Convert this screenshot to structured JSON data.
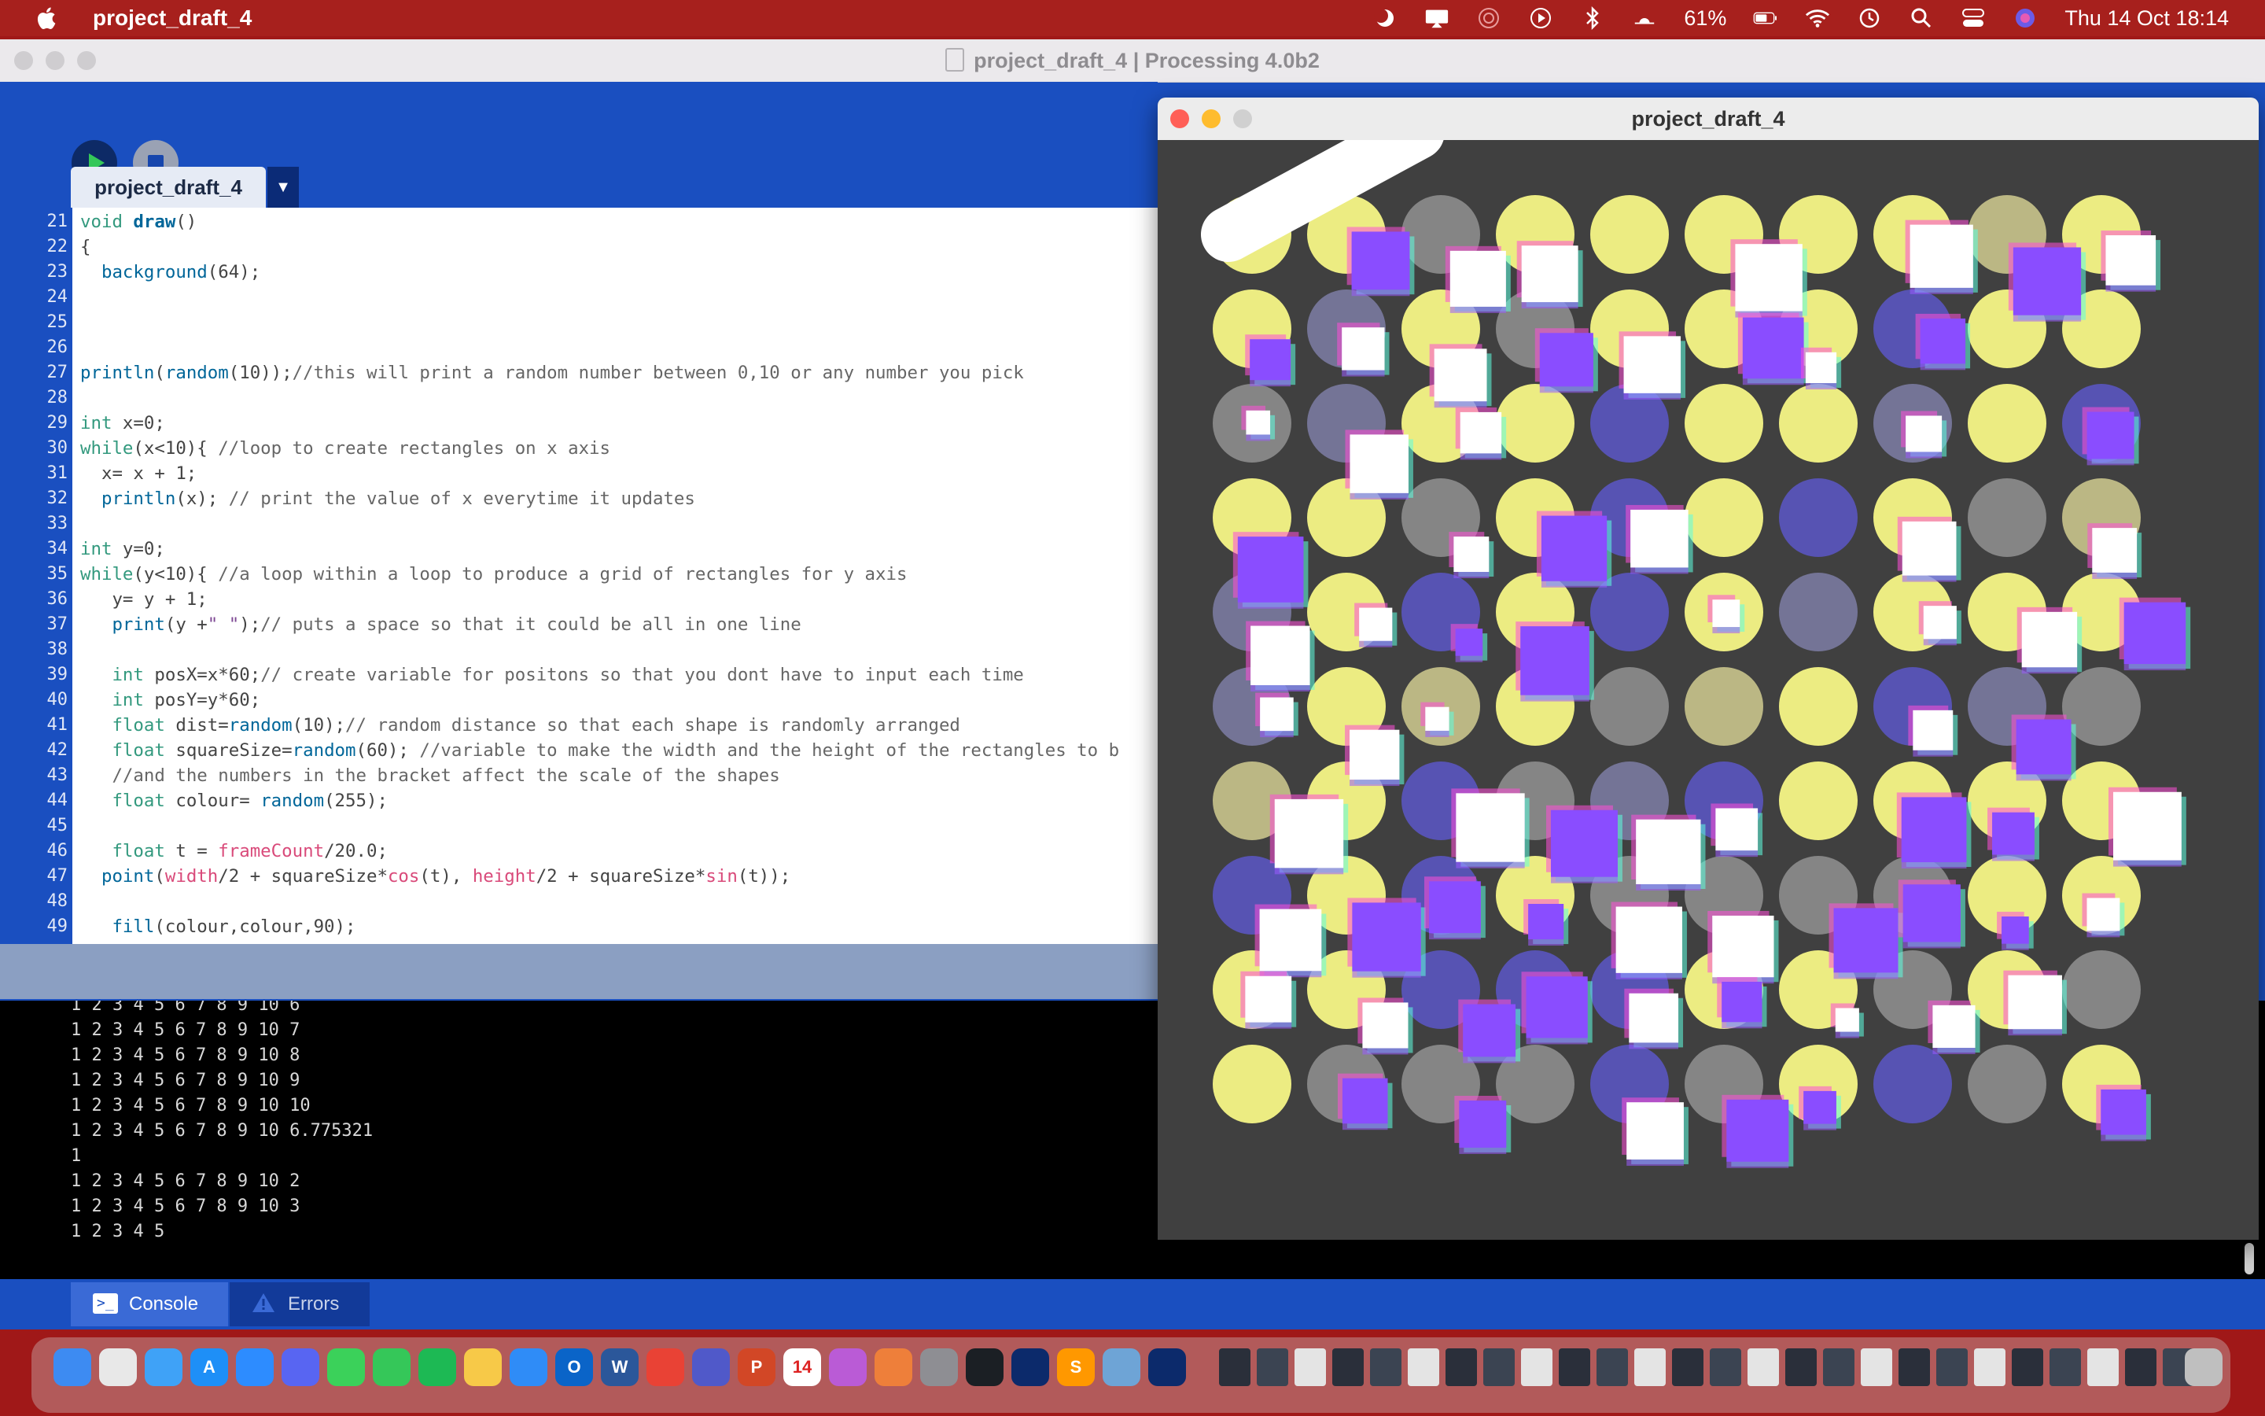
{
  "menubar": {
    "app_name": "project_draft_4",
    "battery": "61%",
    "datetime": "Thu 14 Oct  18:14"
  },
  "ide": {
    "window_title": "project_draft_4 | Processing 4.0b2",
    "tab_label": "project_draft_4",
    "code_lines": [
      {
        "n": "21",
        "html": "<span class='kw'>void</span> <span class='fn bold'>draw</span>()"
      },
      {
        "n": "22",
        "html": "{"
      },
      {
        "n": "23",
        "html": "  <span class='fn'>background</span>(64);"
      },
      {
        "n": "24",
        "html": ""
      },
      {
        "n": "25",
        "html": ""
      },
      {
        "n": "26",
        "html": ""
      },
      {
        "n": "27",
        "html": "<span class='fn'>println</span>(<span class='fn'>random</span>(10));<span class='cm'>//this will print a random number between 0,10 or any number you pick</span>"
      },
      {
        "n": "28",
        "html": ""
      },
      {
        "n": "29",
        "html": "<span class='kw'>int</span> x=0;"
      },
      {
        "n": "30",
        "html": "<span class='kw'>while</span>(x&lt;10){ <span class='cm'>//loop to create rectangles on x axis</span>"
      },
      {
        "n": "31",
        "html": "  x= x + 1;"
      },
      {
        "n": "32",
        "html": "  <span class='fn'>println</span>(x); <span class='cm'>// print the value of x everytime it updates</span>"
      },
      {
        "n": "33",
        "html": ""
      },
      {
        "n": "34",
        "html": "<span class='kw'>int</span> y=0;"
      },
      {
        "n": "35",
        "html": "<span class='kw'>while</span>(y&lt;10){ <span class='cm'>//a loop within a loop to produce a grid of rectangles for y axis</span>"
      },
      {
        "n": "36",
        "html": "   y= y + 1;"
      },
      {
        "n": "37",
        "html": "   <span class='fn'>print</span>(y +<span class='st'>\" \"</span>);<span class='cm'>// puts a space so that it could be all in one line</span>"
      },
      {
        "n": "38",
        "html": ""
      },
      {
        "n": "39",
        "html": "   <span class='kw'>int</span> posX=x*60;<span class='cm'>// create variable for positons so that you dont have to input each time</span>"
      },
      {
        "n": "40",
        "html": "   <span class='kw'>int</span> posY=y*60;"
      },
      {
        "n": "41",
        "html": "   <span class='kw'>float</span> dist=<span class='fn'>random</span>(10);<span class='cm'>// random distance so that each shape is randomly arranged</span>"
      },
      {
        "n": "42",
        "html": "   <span class='kw'>float</span> squareSize=<span class='fn'>random</span>(60); <span class='cm'>//variable to make the width and the height of the rectangles to b</span>"
      },
      {
        "n": "43",
        "html": "   <span class='cm'>//and the numbers in the bracket affect the scale of the shapes</span>"
      },
      {
        "n": "44",
        "html": "   <span class='kw'>float</span> colour= <span class='fn'>random</span>(255);"
      },
      {
        "n": "45",
        "html": ""
      },
      {
        "n": "46",
        "html": "   <span class='kw'>float</span> t = <span class='sys'>frameCount</span>/20.0;"
      },
      {
        "n": "47",
        "html": "  <span class='fn'>point</span>(<span class='sys'>width</span>/2 + squareSize*<span class='sys'>cos</span>(t), <span class='sys'>height</span>/2 + squareSize*<span class='sys'>sin</span>(t));"
      },
      {
        "n": "48",
        "html": ""
      },
      {
        "n": "49",
        "html": "   <span class='fn'>fill</span>(colour,colour,90);"
      }
    ],
    "console_lines": [
      "1 2 3 4 5 6 7 8 9 10 6",
      "1 2 3 4 5 6 7 8 9 10 7",
      "1 2 3 4 5 6 7 8 9 10 8",
      "1 2 3 4 5 6 7 8 9 10 9",
      "1 2 3 4 5 6 7 8 9 10 10",
      "1 2 3 4 5 6 7 8 9 10 6.775321",
      "1",
      "1 2 3 4 5 6 7 8 9 10 2",
      "1 2 3 4 5 6 7 8 9 10 3",
      "1 2 3 4 5"
    ],
    "console_tab": "Console",
    "errors_tab": "Errors"
  },
  "sketch": {
    "window_title": "project_draft_4",
    "background": "#404040",
    "grid_cols": 10,
    "grid_rows": 10
  },
  "colors": {
    "ide_blue": "#1a4fc0",
    "menubar_red": "#a7201d",
    "keyword_green": "#33997e",
    "function_blue": "#006699"
  },
  "dock": {
    "icons": [
      {
        "name": "finder",
        "color": "#3d8bf2",
        "glyph": ""
      },
      {
        "name": "launchpad",
        "color": "#e8e8e8",
        "glyph": ""
      },
      {
        "name": "mail",
        "color": "#3fa2f7",
        "glyph": ""
      },
      {
        "name": "app-store",
        "color": "#1e8ff7",
        "glyph": "A"
      },
      {
        "name": "zoom",
        "color": "#2d8cff",
        "glyph": ""
      },
      {
        "name": "discord",
        "color": "#5865f2",
        "glyph": ""
      },
      {
        "name": "messages",
        "color": "#3bd15a",
        "glyph": ""
      },
      {
        "name": "facetime",
        "color": "#35c759",
        "glyph": ""
      },
      {
        "name": "spotify",
        "color": "#1db954",
        "glyph": ""
      },
      {
        "name": "photos",
        "color": "#f7c948",
        "glyph": ""
      },
      {
        "name": "safari",
        "color": "#2f8cf7",
        "glyph": ""
      },
      {
        "name": "outlook",
        "color": "#0a64c8",
        "glyph": "O"
      },
      {
        "name": "word",
        "color": "#2b579a",
        "glyph": "W"
      },
      {
        "name": "chrome",
        "color": "#e94235",
        "glyph": ""
      },
      {
        "name": "teams",
        "color": "#5059c9",
        "glyph": ""
      },
      {
        "name": "powerpoint",
        "color": "#d24726",
        "glyph": "P"
      },
      {
        "name": "calendar",
        "color": "#ffffff",
        "glyph": "14"
      },
      {
        "name": "arc",
        "color": "#ba5bd6",
        "glyph": ""
      },
      {
        "name": "books",
        "color": "#ee7f3a",
        "glyph": ""
      },
      {
        "name": "system-preferences",
        "color": "#8e8e93",
        "glyph": ""
      },
      {
        "name": "github",
        "color": "#1b1f24",
        "glyph": ""
      },
      {
        "name": "processing",
        "color": "#0c2a6b",
        "glyph": ""
      },
      {
        "name": "sublime",
        "color": "#ff9800",
        "glyph": "S"
      },
      {
        "name": "preview",
        "color": "#6ea4d6",
        "glyph": ""
      },
      {
        "name": "processing-2",
        "color": "#0c2a6b",
        "glyph": ""
      }
    ]
  }
}
